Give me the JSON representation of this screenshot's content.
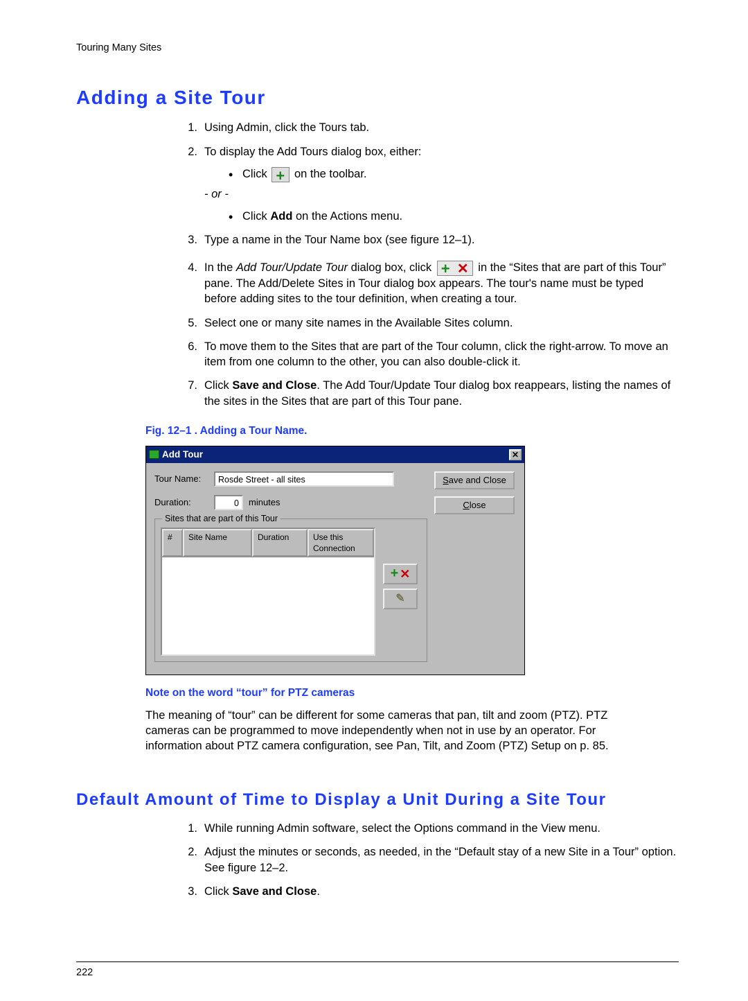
{
  "header": {
    "running": "Touring Many Sites"
  },
  "section1": {
    "title": "Adding a Site Tour",
    "steps": {
      "s1": {
        "num": "1.",
        "text": "Using Admin, click the Tours tab."
      },
      "s2": {
        "num": "2.",
        "text": "To display the Add Tours dialog box, either:",
        "bullet1_pre": "Click ",
        "bullet1_post": " on the toolbar.",
        "or": "- or -",
        "bullet2_pre": "Click ",
        "bullet2_bold": "Add",
        "bullet2_post": " on the Actions menu."
      },
      "s3": {
        "num": "3.",
        "text": "Type a name in the Tour Name box (see figure 12–1)."
      },
      "s4": {
        "num": "4.",
        "pre": "In the ",
        "ital": "Add Tour/Update Tour",
        "mid": " dialog box, click ",
        "post": " in the “Sites that are part of this Tour” pane. The Add/Delete Sites in Tour dialog box appears. The tour's name must be typed before adding sites to the tour definition, when creating a tour."
      },
      "s5": {
        "num": "5.",
        "text": "Select one or many site names in the Available Sites column."
      },
      "s6": {
        "num": "6.",
        "text": "To move them to the Sites that are part of the Tour column, click the right-arrow. To move an item from one column to the other, you can also double-click it."
      },
      "s7": {
        "num": "7.",
        "pre": "Click ",
        "bold": "Save and Close",
        "post": ". The Add Tour/Update Tour dialog box reappears, listing the names of the sites in the Sites that are part of this Tour pane."
      }
    }
  },
  "figure": {
    "caption": "Fig. 12–1 .  Adding a Tour Name.",
    "dialog": {
      "title": "Add Tour",
      "tourNameLabel": "Tour Name:",
      "tourNameValue": "Rosde Street - all sites",
      "durationLabel": "Duration:",
      "durationValue": "0",
      "durationUnit": "minutes",
      "saveClose_u": "S",
      "saveClose_rest": "ave and Close",
      "close_u": "C",
      "close_rest": "lose",
      "groupLegend": "Sites that are part of this Tour",
      "col_num": "#",
      "col_site": "Site Name",
      "col_dur": "Duration",
      "col_conn": "Use this Connection",
      "closeX": "✕"
    }
  },
  "note": {
    "caption": "Note on the word “tour” for PTZ cameras",
    "body": "The meaning of “tour” can be different for some cameras that pan, tilt and zoom (PTZ). PTZ cameras can be programmed to move independently when not in use by an operator. For information about PTZ camera configuration, see Pan, Tilt, and Zoom (PTZ) Setup on p. 85."
  },
  "section2": {
    "title": "Default Amount of Time to Display a Unit During a Site Tour",
    "steps": {
      "s1": {
        "num": "1.",
        "text": "While running Admin software, select the Options command in the View menu."
      },
      "s2": {
        "num": "2.",
        "text": "Adjust the minutes or seconds, as needed, in the “Default stay of a new Site in a Tour” option. See figure 12–2."
      },
      "s3": {
        "num": "3.",
        "pre": "Click ",
        "bold": "Save and Close",
        "post": "."
      }
    }
  },
  "footer": {
    "page": "222"
  }
}
